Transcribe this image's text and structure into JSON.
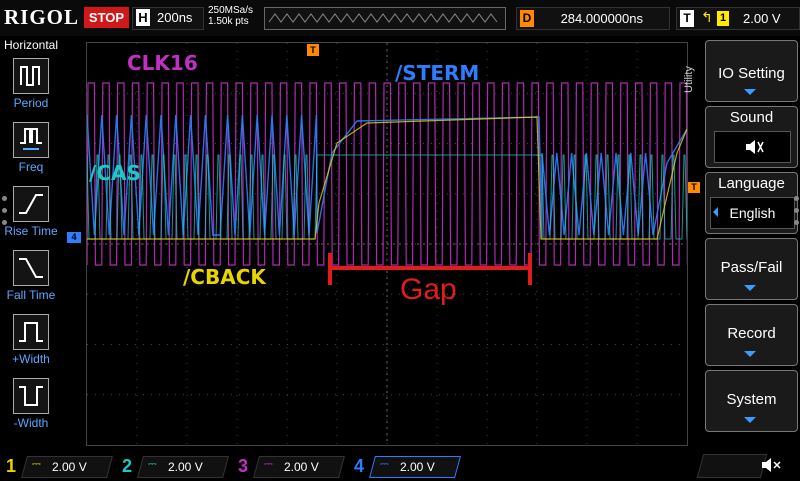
{
  "top": {
    "brand": "RIGOL",
    "run_state": "STOP",
    "timebase_letter": "H",
    "timebase": "200ns",
    "sample_rate": "250MSa/s",
    "memory_depth": "1.50k pts",
    "trigger_mark": "T",
    "delay_letter": "D",
    "delay": "284.000000ns",
    "trigger_letter": "T",
    "trigger_edge": "↰",
    "trigger_source": "1",
    "trigger_level": "2.00 V"
  },
  "left_panel": {
    "title": "Horizontal",
    "items": [
      {
        "label": "Period",
        "icon": "period-icon"
      },
      {
        "label": "Freq",
        "icon": "freq-icon"
      },
      {
        "label": "Rise Time",
        "icon": "rise-time-icon"
      },
      {
        "label": "Fall Time",
        "icon": "fall-time-icon"
      },
      {
        "label": "+Width",
        "icon": "pos-width-icon"
      },
      {
        "label": "-Width",
        "icon": "neg-width-icon"
      }
    ]
  },
  "screen": {
    "labels": {
      "clk16": "CLK16",
      "sterm": "/STERM",
      "cas": "/CAS",
      "cback": "/CBACK",
      "gap": "Gap"
    },
    "colors": {
      "ch1": "#e8d400",
      "ch2": "#1ec9c3",
      "ch3": "#c22fc4",
      "ch4": "#2e7dff",
      "gap": "#e21b1b"
    },
    "markers": {
      "ch4_marker": "4",
      "trigger_level_marker": "T"
    }
  },
  "right_menu": {
    "side_label": "Utility",
    "items": [
      {
        "label": "IO Setting",
        "sub": ""
      },
      {
        "label": "Sound",
        "sub": "speaker-icon"
      },
      {
        "label": "Language",
        "sub": "English"
      },
      {
        "label": "Pass/Fail",
        "sub": ""
      },
      {
        "label": "Record",
        "sub": ""
      },
      {
        "label": "System",
        "sub": ""
      }
    ]
  },
  "channels": [
    {
      "num": "1",
      "value": "2.00 V",
      "color": "#e8d400"
    },
    {
      "num": "2",
      "value": "2.00 V",
      "color": "#1ec9c3"
    },
    {
      "num": "3",
      "value": "2.00 V",
      "color": "#c22fc4"
    },
    {
      "num": "4",
      "value": "2.00 V",
      "color": "#2e7dff"
    }
  ]
}
